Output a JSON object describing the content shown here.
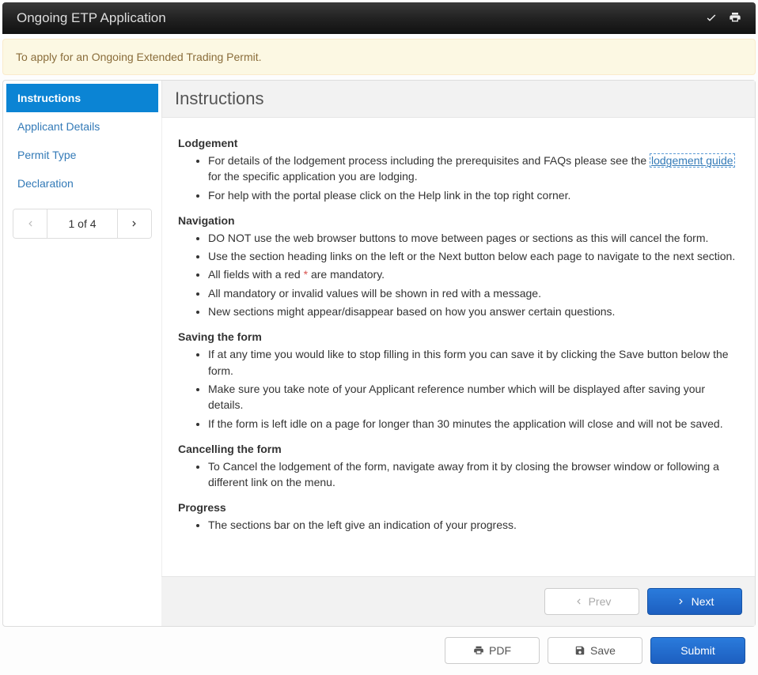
{
  "header": {
    "title": "Ongoing ETP Application"
  },
  "banner": {
    "text": "To apply for an Ongoing Extended Trading Permit."
  },
  "sidebar": {
    "items": [
      {
        "label": "Instructions",
        "active": true
      },
      {
        "label": "Applicant Details",
        "active": false
      },
      {
        "label": "Permit Type",
        "active": false
      },
      {
        "label": "Declaration",
        "active": false
      }
    ],
    "pager": "1 of 4"
  },
  "content": {
    "title": "Instructions",
    "lodgement_h": "Lodgement",
    "lodgement": {
      "pre": "For details of the lodgement process including the prerequisites and FAQs please see the ",
      "link": "lodgement guide",
      "post": " for the specific application you are lodging."
    },
    "lodgement2": "For help with the portal please click on the Help link in the top right corner.",
    "navigation_h": "Navigation",
    "nav1": "DO NOT use the web browser buttons to move between pages or sections as this will cancel the form.",
    "nav2": "Use the section heading links on the left or the Next button below each page to navigate to the next section.",
    "nav3_pre": "All fields with a red ",
    "nav3_ast": "*",
    "nav3_post": " are mandatory.",
    "nav4": "All mandatory or invalid values will be shown in red with a message.",
    "nav5": "New sections might appear/disappear based on how you answer certain questions.",
    "saving_h": "Saving the form",
    "sav1": "If at any time you would like to stop filling in this form you can save it by clicking the Save button below the form.",
    "sav2": "Make sure you take note of your Applicant reference number which will be displayed after saving your details.",
    "sav3": "If the form is left idle on a page for longer than 30 minutes the application will close and will not be saved.",
    "cancelling_h": "Cancelling the form",
    "can1": "To Cancel the lodgement of the form, navigate away from it by closing the browser window or following a different link on the menu.",
    "progress_h": "Progress",
    "prog1": "The sections bar on the left give an indication of your progress."
  },
  "buttons": {
    "prev": "Prev",
    "next": "Next",
    "pdf": "PDF",
    "save": "Save",
    "submit": "Submit"
  }
}
